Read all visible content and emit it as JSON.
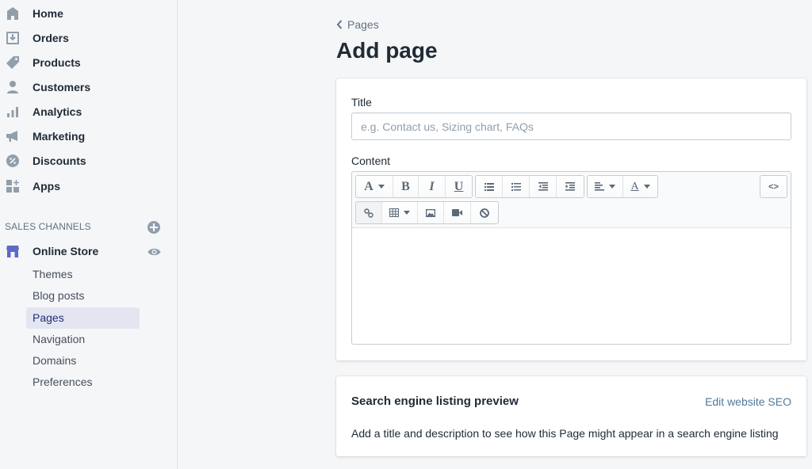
{
  "sidebar": {
    "items": [
      {
        "label": "Home",
        "icon": "home-icon"
      },
      {
        "label": "Orders",
        "icon": "orders-icon"
      },
      {
        "label": "Products",
        "icon": "tag-icon"
      },
      {
        "label": "Customers",
        "icon": "person-icon"
      },
      {
        "label": "Analytics",
        "icon": "bar-chart-icon"
      },
      {
        "label": "Marketing",
        "icon": "megaphone-icon"
      },
      {
        "label": "Discounts",
        "icon": "discount-icon"
      },
      {
        "label": "Apps",
        "icon": "apps-icon"
      }
    ],
    "sales_channels_title": "SALES CHANNELS",
    "online_store": {
      "label": "Online Store",
      "sub_items": [
        {
          "label": "Themes",
          "active": false
        },
        {
          "label": "Blog posts",
          "active": false
        },
        {
          "label": "Pages",
          "active": true
        },
        {
          "label": "Navigation",
          "active": false
        },
        {
          "label": "Domains",
          "active": false
        },
        {
          "label": "Preferences",
          "active": false
        }
      ]
    }
  },
  "header": {
    "breadcrumb": "Pages",
    "title": "Add page"
  },
  "form": {
    "title_label": "Title",
    "title_value": "",
    "title_placeholder": "e.g. Contact us, Sizing chart, FAQs",
    "content_label": "Content",
    "content_value": "",
    "toolbar": {
      "font_label": "A",
      "bold_label": "B",
      "italic_label": "I",
      "underline_label": "U",
      "text_color_label": "A",
      "html_label": "<>"
    }
  },
  "seo": {
    "title": "Search engine listing preview",
    "edit_link": "Edit website SEO",
    "description": "Add a title and description to see how this Page might appear in a search engine listing"
  },
  "colors": {
    "active_nav_text": "#202e78",
    "link": "#4e7a9a",
    "store_icon": "#5c6ac4"
  }
}
